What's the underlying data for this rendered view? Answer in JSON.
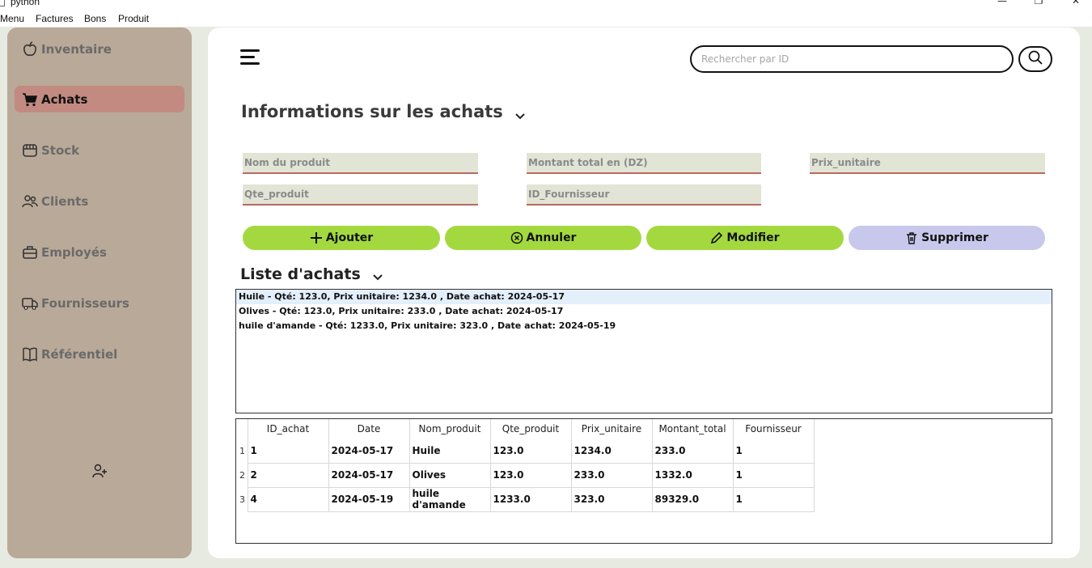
{
  "window": {
    "title": "python",
    "minimize": "—",
    "maximize": "❐",
    "close": "✕"
  },
  "menubar": [
    "Menu",
    "Factures",
    "Bons",
    "Produit"
  ],
  "sidebar": {
    "items": [
      {
        "label": "Inventaire",
        "icon": "apple-icon",
        "active": false
      },
      {
        "label": "Achats",
        "icon": "cart-icon",
        "active": true
      },
      {
        "label": "Stock",
        "icon": "store-icon",
        "active": false
      },
      {
        "label": "Clients",
        "icon": "users-icon",
        "active": false
      },
      {
        "label": "Employés",
        "icon": "briefcase-icon",
        "active": false
      },
      {
        "label": "Fournisseurs",
        "icon": "truck-icon",
        "active": false
      },
      {
        "label": "Référentiel",
        "icon": "book-icon",
        "active": false
      }
    ],
    "add_user_icon": "user-plus-icon"
  },
  "search": {
    "placeholder": "Rechercher par ID"
  },
  "form": {
    "title": "Informations sur les achats",
    "fields": {
      "nom_produit": {
        "placeholder": "Nom du produit",
        "value": ""
      },
      "montant_total": {
        "placeholder": "Montant total en (DZ)",
        "value": ""
      },
      "prix_unitaire": {
        "placeholder": "Prix_unitaire",
        "value": ""
      },
      "qte_produit": {
        "placeholder": "Qte_produit",
        "value": ""
      },
      "id_fournisseur": {
        "placeholder": "ID_Fournisseur",
        "value": ""
      }
    }
  },
  "actions": {
    "ajouter": "Ajouter",
    "annuler": "Annuler",
    "modifier": "Modifier",
    "supprimer": "Supprimer"
  },
  "colors": {
    "sidebar_bg": "#b9a998",
    "active_item": "#c28a80",
    "button_green": "#a3d93e",
    "button_lavender": "#c8c8ec",
    "field_bg": "#e2e4d6",
    "field_underline": "#b86a60"
  },
  "list": {
    "title": "Liste d'achats",
    "items": [
      "Huile - Qté: 123.0, Prix unitaire: 1234.0 , Date achat: 2024-05-17",
      "Olives - Qté: 123.0, Prix unitaire: 233.0 , Date achat: 2024-05-17",
      "huile d'amande - Qté: 1233.0, Prix unitaire: 323.0 , Date achat: 2024-05-19"
    ],
    "selected_index": 0
  },
  "table": {
    "columns": [
      "ID_achat",
      "Date",
      "Nom_produit",
      "Qte_produit",
      "Prix_unitaire",
      "Montant_total",
      "Fournisseur"
    ],
    "rows": [
      {
        "num": "1",
        "cells": [
          "1",
          "2024-05-17",
          "Huile",
          "123.0",
          "1234.0",
          "233.0",
          "1"
        ]
      },
      {
        "num": "2",
        "cells": [
          "2",
          "2024-05-17",
          "Olives",
          "123.0",
          "233.0",
          "1332.0",
          "1"
        ]
      },
      {
        "num": "3",
        "cells": [
          "4",
          "2024-05-19",
          "huile d'amande",
          "1233.0",
          "323.0",
          "89329.0",
          "1"
        ]
      }
    ]
  }
}
